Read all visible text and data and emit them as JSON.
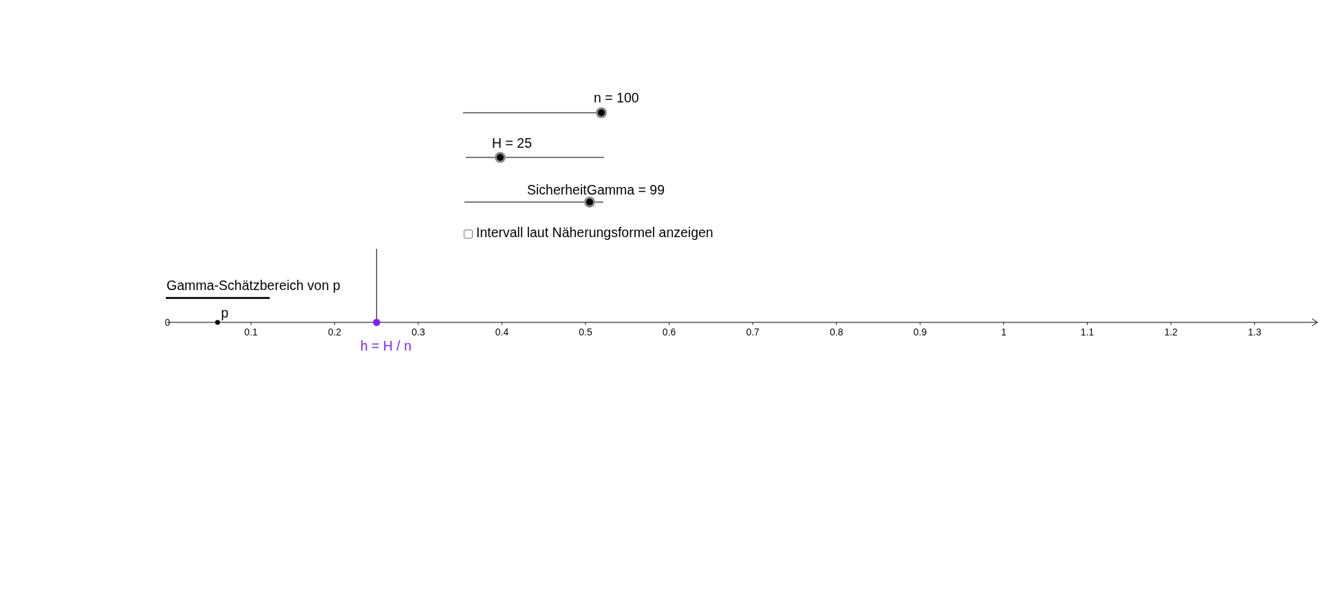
{
  "sliders": [
    {
      "label": "n = 100",
      "level": 1
    },
    {
      "label": "H = 25",
      "level": 0.25
    },
    {
      "label": "SicherheitGamma = 99",
      "level": 0.9
    }
  ],
  "checkbox": {
    "label": "Intervall laut Näherungsformel anzeigen",
    "checked": false
  },
  "caption": "Gamma-Schätzbereich von p",
  "number_line": {
    "tick_labels": [
      "0",
      "0.1",
      "0.2",
      "0.3",
      "0.4",
      "0.5",
      "0.6",
      "0.7",
      "0.8",
      "0.9",
      "1",
      "1.1",
      "1.2",
      "1.3"
    ],
    "points": [
      {
        "label": "p",
        "color": "#000000"
      },
      {
        "label": "h = H / n",
        "color": "#7f1fff"
      }
    ]
  }
}
